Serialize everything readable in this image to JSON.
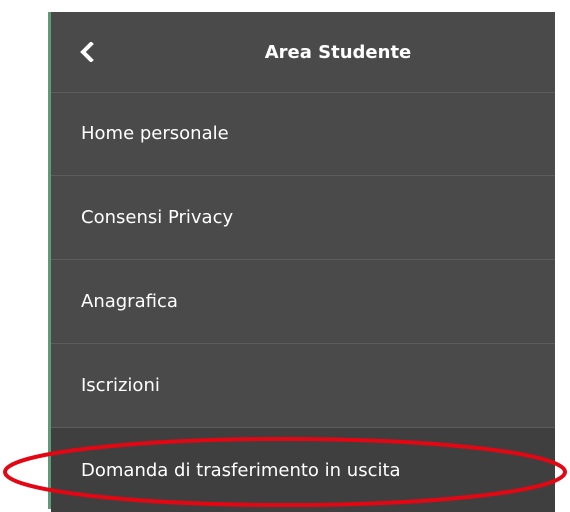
{
  "header": {
    "back_icon": "chevron-left-icon",
    "title": "Area Studente"
  },
  "menu": {
    "items": [
      {
        "label": "Home personale"
      },
      {
        "label": "Consensi Privacy"
      },
      {
        "label": "Anagrafica"
      },
      {
        "label": "Iscrizioni"
      },
      {
        "label": "Domanda di trasferimento in uscita",
        "highlighted": true
      }
    ]
  },
  "colors": {
    "panel_background": "#4a4a4a",
    "accent_border": "#5e9a78",
    "highlight_ring": "#e30613",
    "text": "#ffffff"
  }
}
